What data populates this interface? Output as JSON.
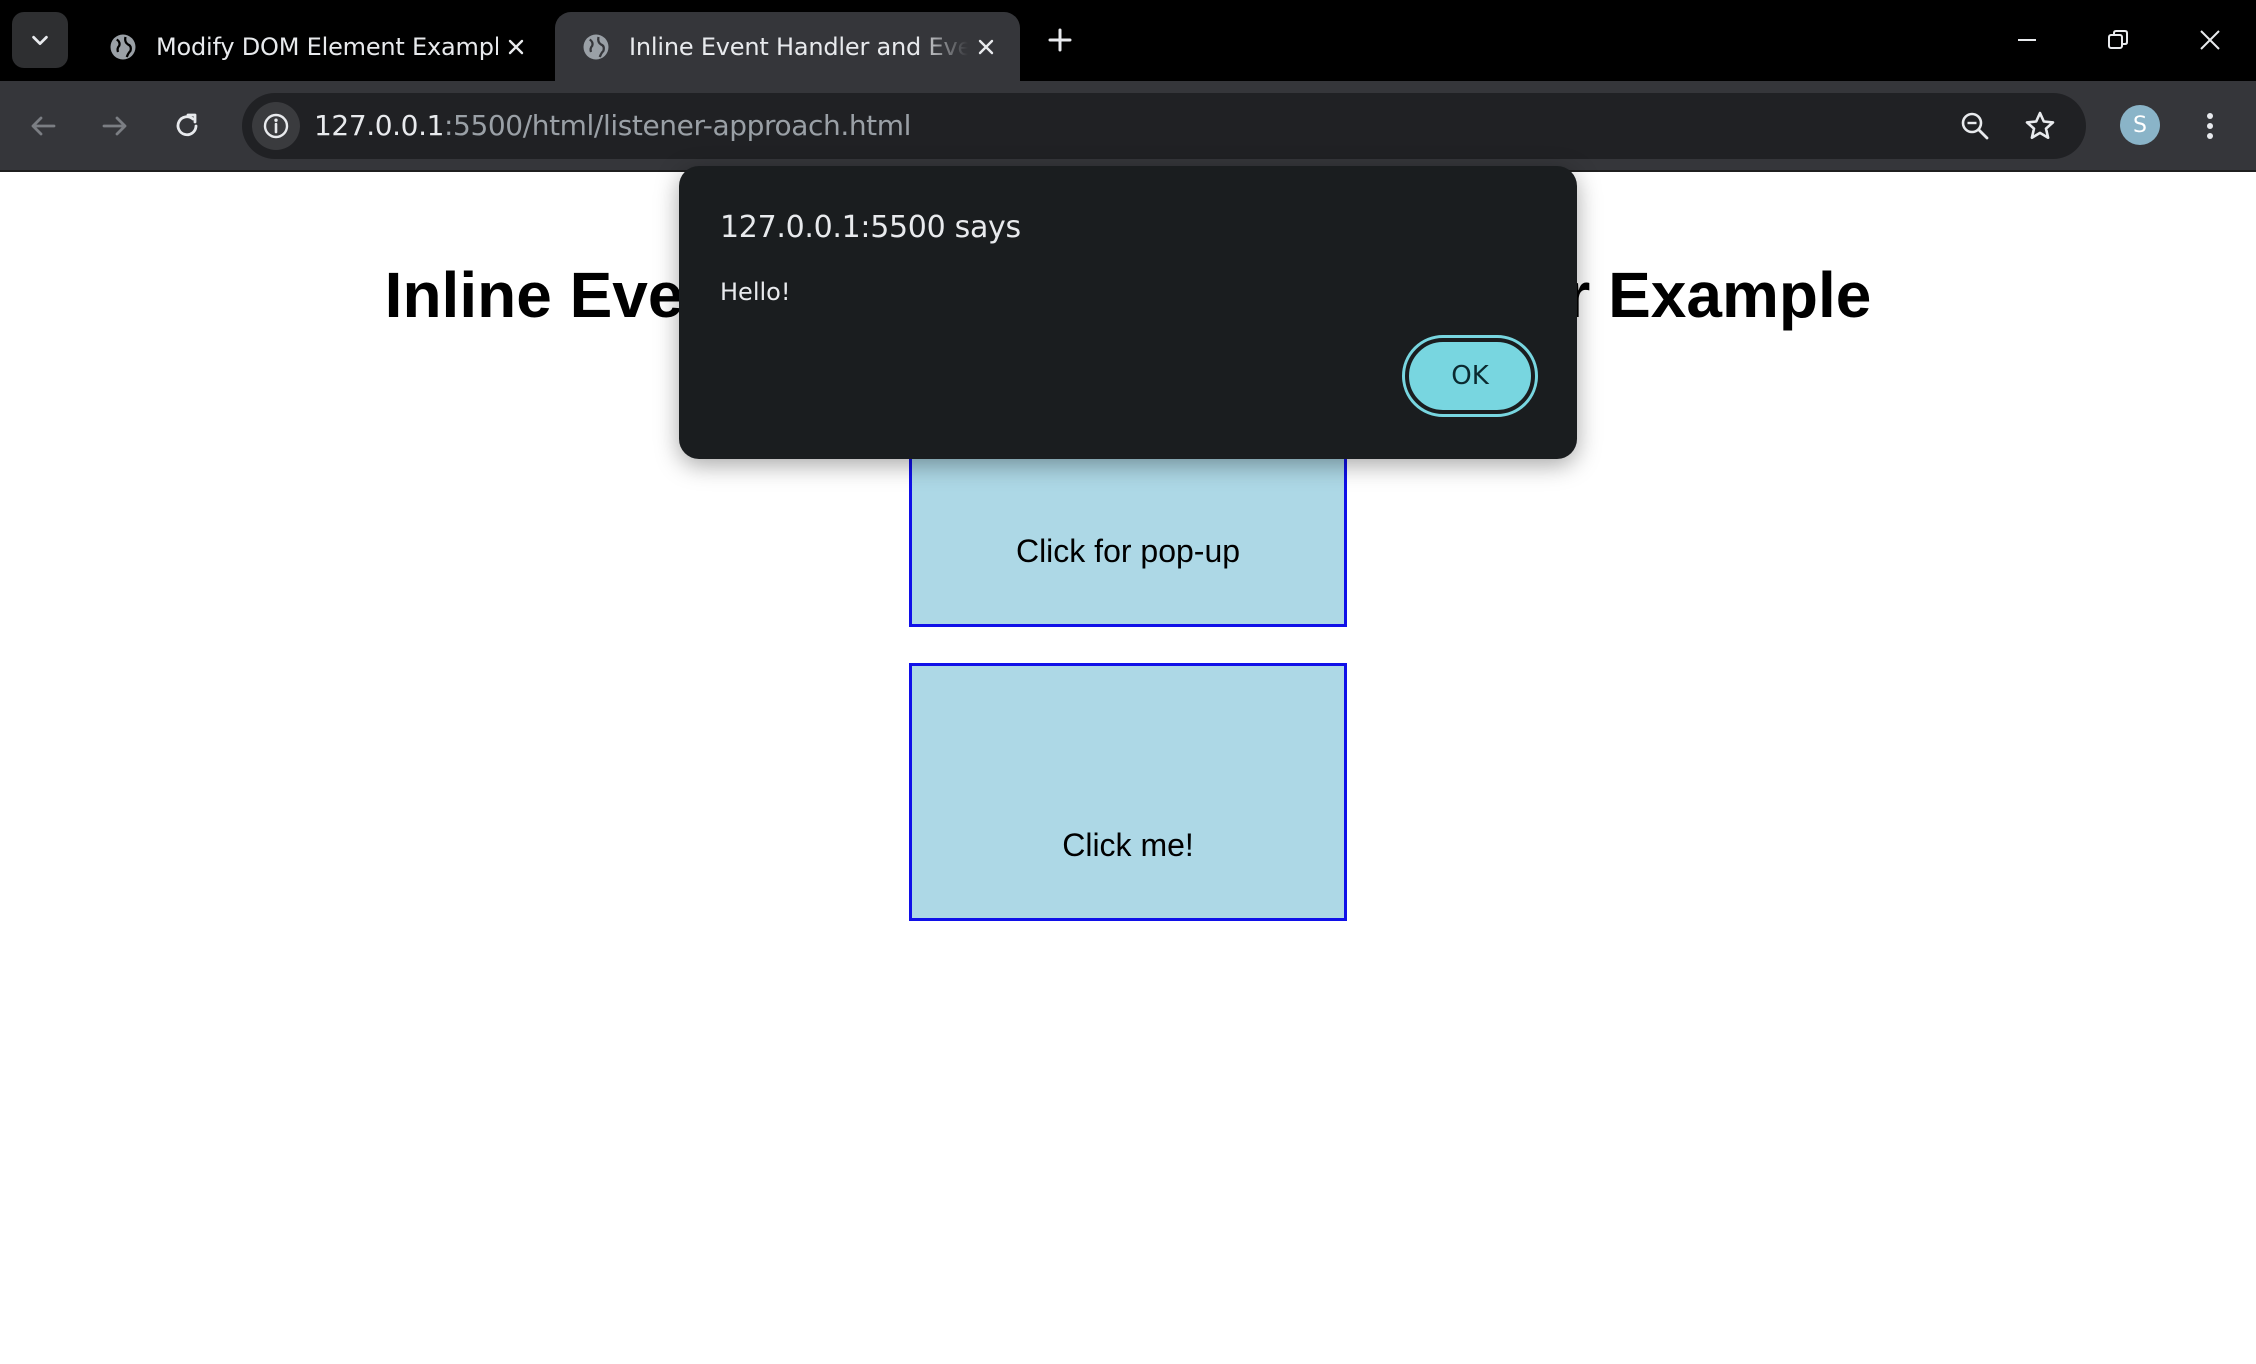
{
  "browser": {
    "tabs": [
      {
        "title": "Modify DOM Element Example",
        "active": false
      },
      {
        "title": "Inline Event Handler and Event Listener Example",
        "active": true
      }
    ],
    "url": {
      "host": "127.0.0.1",
      "rest": ":5500/html/listener-approach.html"
    },
    "profile_initial": "S",
    "colors": {
      "frame": "#000000",
      "toolbar": "#35363a",
      "omnibox": "#202124"
    }
  },
  "page": {
    "heading": "Inline Event Handler and Event Listener Example",
    "box1_label": "Click for pop-up",
    "box2_label": "Click me!",
    "colors": {
      "box_fill": "#add8e6",
      "box_border": "#1010e8"
    }
  },
  "dialog": {
    "title": "127.0.0.1:5500 says",
    "message": "Hello!",
    "ok_label": "OK",
    "colors": {
      "background": "#1a1d1f",
      "button": "#78d6e0"
    }
  }
}
